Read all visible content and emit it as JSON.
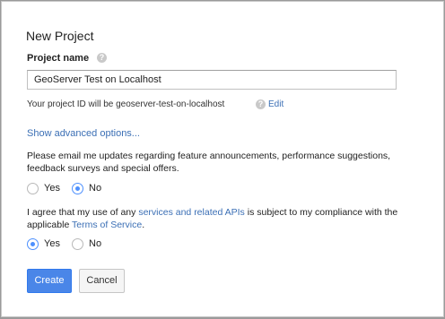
{
  "dialog": {
    "title": "New Project",
    "project_name_label": "Project name",
    "help_icon_glyph": "?",
    "project_name_value": "GeoServer Test on Localhost",
    "project_id_text": "Your project ID will be geoserver-test-on-localhost",
    "edit_link": "Edit",
    "advanced_link": "Show advanced options...",
    "email_prompt": "Please email me updates regarding feature announcements, performance suggestions, feedback surveys and special offers.",
    "email_options": {
      "yes": "Yes",
      "no": "No",
      "selected": "No"
    },
    "terms_prefix": "I agree that my use of any ",
    "terms_link_apis": "services and related APIs",
    "terms_middle": " is subject to my compliance with the applicable ",
    "terms_link_tos": "Terms of Service",
    "terms_suffix": ".",
    "terms_options": {
      "yes": "Yes",
      "no": "No",
      "selected": "Yes"
    },
    "create_button": "Create",
    "cancel_button": "Cancel"
  },
  "colors": {
    "accent": "#4a86e8",
    "link": "#3b6fb5",
    "radio_selected": "#4d90fe"
  },
  "icons": {
    "help": "help-icon"
  }
}
